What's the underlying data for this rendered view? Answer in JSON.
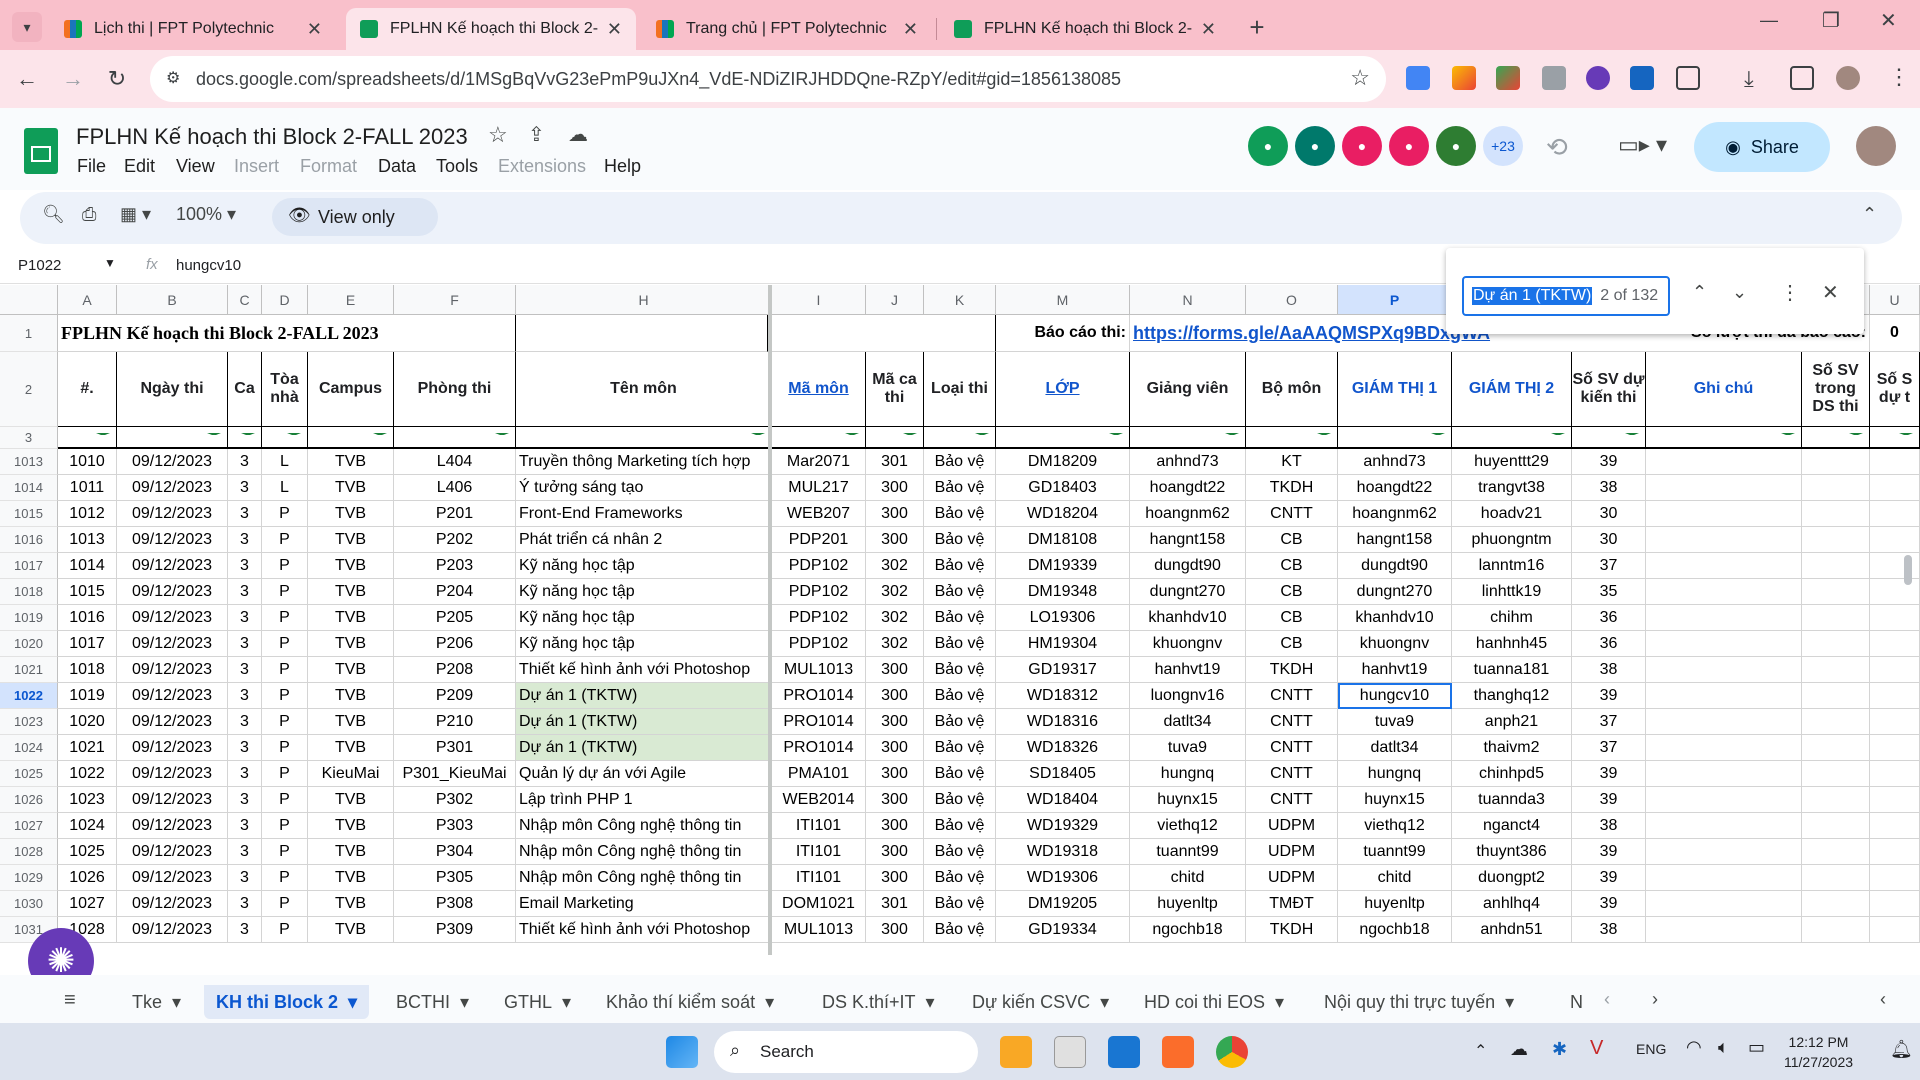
{
  "browser": {
    "tabs": [
      {
        "title": "Lịch thi | FPT Polytechnic",
        "active": false
      },
      {
        "title": "FPLHN Kế hoạch thi Block 2-FA",
        "active": true
      },
      {
        "title": "Trang chủ | FPT Polytechnic",
        "active": false
      },
      {
        "title": "FPLHN Kế hoạch thi Block 2-FA",
        "active": false
      }
    ],
    "url": "docs.google.com/spreadsheets/d/1MSgBqVvG23ePmP9uJXn4_VdE-NDiZIRJHDDQne-RZpY/edit#gid=1856138085"
  },
  "doc": {
    "title": "FPLHN Kế hoạch thi Block 2-FALL 2023",
    "menus": [
      "File",
      "Edit",
      "View",
      "Insert",
      "Format",
      "Data",
      "Tools",
      "Extensions",
      "Help"
    ],
    "extra_collaborators": "+23",
    "share_label": "Share"
  },
  "toolbar": {
    "zoom": "100%",
    "view_only_label": "View only"
  },
  "formula_bar": {
    "cell_ref": "P1022",
    "fx": "fx",
    "value": "hungcv10"
  },
  "columns": [
    "A",
    "B",
    "C",
    "D",
    "E",
    "F",
    "H",
    "I",
    "J",
    "K",
    "M",
    "N",
    "O",
    "P",
    "Q",
    "R",
    "S",
    "T",
    "U"
  ],
  "sheet_title": "FPLHN Kế hoạch thi Block 2-FALL 2023",
  "report_label": "Báo cáo thi:",
  "report_link": "https://forms.gle/AaAAQMSPXq9BDxgWA",
  "report_count_label": "Số lượt thi đã báo cáo:",
  "report_count_value": "0",
  "headers": {
    "no": "#.",
    "date": "Ngày thi",
    "shift": "Ca",
    "building": "Tòa nhà",
    "campus": "Campus",
    "room": "Phòng thi",
    "subject": "Tên môn",
    "code": "Mã môn",
    "exam_code": "Mã ca thi",
    "exam_type": "Loại thi",
    "class": "LỚP",
    "lecturer": "Giảng viên",
    "dept": "Bộ môn",
    "proctor1": "GIÁM THỊ 1",
    "proctor2": "GIÁM THỊ 2",
    "expected": "Số SV dự kiến thi",
    "note": "Ghi chú",
    "in_list": "Số SV trong DS thi",
    "last": "Số S dự t"
  },
  "row_numbers": [
    "1",
    "2",
    "3",
    "1013",
    "1014",
    "1015",
    "1016",
    "1017",
    "1018",
    "1019",
    "1020",
    "1021",
    "1022",
    "1023",
    "1024",
    "1025",
    "1026",
    "1027",
    "1028",
    "1029",
    "1030",
    "1031"
  ],
  "rows": [
    [
      "1010",
      "09/12/2023",
      "3",
      "L",
      "TVB",
      "L404",
      "Truyền thông Marketing tích hợp",
      "Mar2071",
      "301",
      "Bảo vệ",
      "DM18209",
      "anhnd73",
      "KT",
      "anhnd73",
      "huyenttt29",
      "39"
    ],
    [
      "1011",
      "09/12/2023",
      "3",
      "L",
      "TVB",
      "L406",
      "Ý tưởng sáng tạo",
      "MUL217",
      "300",
      "Bảo vệ",
      "GD18403",
      "hoangdt22",
      "TKDH",
      "hoangdt22",
      "trangvt38",
      "38"
    ],
    [
      "1012",
      "09/12/2023",
      "3",
      "P",
      "TVB",
      "P201",
      "Front-End Frameworks",
      "WEB207",
      "300",
      "Bảo vệ",
      "WD18204",
      "hoangnm62",
      "CNTT",
      "hoangnm62",
      "hoadv21",
      "30"
    ],
    [
      "1013",
      "09/12/2023",
      "3",
      "P",
      "TVB",
      "P202",
      "Phát triển cá nhân 2",
      "PDP201",
      "300",
      "Bảo vệ",
      "DM18108",
      "hangnt158",
      "CB",
      "hangnt158",
      "phuongntm",
      "30"
    ],
    [
      "1014",
      "09/12/2023",
      "3",
      "P",
      "TVB",
      "P203",
      "Kỹ năng học tập",
      "PDP102",
      "302",
      "Bảo vệ",
      "DM19339",
      "dungdt90",
      "CB",
      "dungdt90",
      "lanntm16",
      "37"
    ],
    [
      "1015",
      "09/12/2023",
      "3",
      "P",
      "TVB",
      "P204",
      "Kỹ năng học tập",
      "PDP102",
      "302",
      "Bảo vệ",
      "DM19348",
      "dungnt270",
      "CB",
      "dungnt270",
      "linhttk19",
      "35"
    ],
    [
      "1016",
      "09/12/2023",
      "3",
      "P",
      "TVB",
      "P205",
      "Kỹ năng học tập",
      "PDP102",
      "302",
      "Bảo vệ",
      "LO19306",
      "khanhdv10",
      "CB",
      "khanhdv10",
      "chihm",
      "36"
    ],
    [
      "1017",
      "09/12/2023",
      "3",
      "P",
      "TVB",
      "P206",
      "Kỹ năng học tập",
      "PDP102",
      "302",
      "Bảo vệ",
      "HM19304",
      "khuongnv",
      "CB",
      "khuongnv",
      "hanhnh45",
      "36"
    ],
    [
      "1018",
      "09/12/2023",
      "3",
      "P",
      "TVB",
      "P208",
      "Thiết kế hình ảnh với Photoshop",
      "MUL1013",
      "300",
      "Bảo vệ",
      "GD19317",
      "hanhvt19",
      "TKDH",
      "hanhvt19",
      "tuanna181",
      "38"
    ],
    [
      "1019",
      "09/12/2023",
      "3",
      "P",
      "TVB",
      "P209",
      "Dự án 1 (TKTW)",
      "PRO1014",
      "300",
      "Bảo vệ",
      "WD18312",
      "luongnv16",
      "CNTT",
      "hungcv10",
      "thanghq12",
      "39"
    ],
    [
      "1020",
      "09/12/2023",
      "3",
      "P",
      "TVB",
      "P210",
      "Dự án 1 (TKTW)",
      "PRO1014",
      "300",
      "Bảo vệ",
      "WD18316",
      "datlt34",
      "CNTT",
      "tuva9",
      "anph21",
      "37"
    ],
    [
      "1021",
      "09/12/2023",
      "3",
      "P",
      "TVB",
      "P301",
      "Dự án 1 (TKTW)",
      "PRO1014",
      "300",
      "Bảo vệ",
      "WD18326",
      "tuva9",
      "CNTT",
      "datlt34",
      "thaivm2",
      "37"
    ],
    [
      "1022",
      "09/12/2023",
      "3",
      "P",
      "KieuMai",
      "P301_KieuMai",
      "Quản lý dự án với Agile",
      "PMA101",
      "300",
      "Bảo vệ",
      "SD18405",
      "hungnq",
      "CNTT",
      "hungnq",
      "chinhpd5",
      "39"
    ],
    [
      "1023",
      "09/12/2023",
      "3",
      "P",
      "TVB",
      "P302",
      "Lập trình PHP 1",
      "WEB2014",
      "300",
      "Bảo vệ",
      "WD18404",
      "huynx15",
      "CNTT",
      "huynx15",
      "tuannda3",
      "39"
    ],
    [
      "1024",
      "09/12/2023",
      "3",
      "P",
      "TVB",
      "P303",
      "Nhập môn Công nghệ thông tin",
      "ITI101",
      "300",
      "Bảo vệ",
      "WD19329",
      "viethq12",
      "UDPM",
      "viethq12",
      "nganct4",
      "38"
    ],
    [
      "1025",
      "09/12/2023",
      "3",
      "P",
      "TVB",
      "P304",
      "Nhập môn Công nghệ thông tin",
      "ITI101",
      "300",
      "Bảo vệ",
      "WD19318",
      "tuannt99",
      "UDPM",
      "tuannt99",
      "thuynt386",
      "39"
    ],
    [
      "1026",
      "09/12/2023",
      "3",
      "P",
      "TVB",
      "P305",
      "Nhập môn Công nghệ thông tin",
      "ITI101",
      "300",
      "Bảo vệ",
      "WD19306",
      "chitd",
      "UDPM",
      "chitd",
      "duongpt2",
      "39"
    ],
    [
      "1027",
      "09/12/2023",
      "3",
      "P",
      "TVB",
      "P308",
      "Email Marketing",
      "DOM1021",
      "301",
      "Bảo vệ",
      "DM19205",
      "huyenltp",
      "TMĐT",
      "huyenltp",
      "anhlhq4",
      "39"
    ],
    [
      "1028",
      "09/12/2023",
      "3",
      "P",
      "TVB",
      "P309",
      "Thiết kế hình ảnh với Photoshop",
      "MUL1013",
      "300",
      "Bảo vệ",
      "GD19334",
      "ngochb18",
      "TKDH",
      "ngochb18",
      "anhdn51",
      "38"
    ]
  ],
  "find": {
    "query": "Dự án 1 (TKTW)",
    "count": "2 of 132"
  },
  "sheet_tabs": [
    "Tke",
    "KH thi Block 2",
    "BCTHI",
    "GTHL",
    "Khảo thí kiểm soát",
    "DS K.thí+IT",
    "Dự kiến CSVC",
    "HD coi thi EOS",
    "Nội quy thi trực tuyến",
    "N"
  ],
  "taskbar": {
    "search_placeholder": "Search",
    "lang": "ENG",
    "time": "12:12 PM",
    "date": "11/27/2023"
  }
}
